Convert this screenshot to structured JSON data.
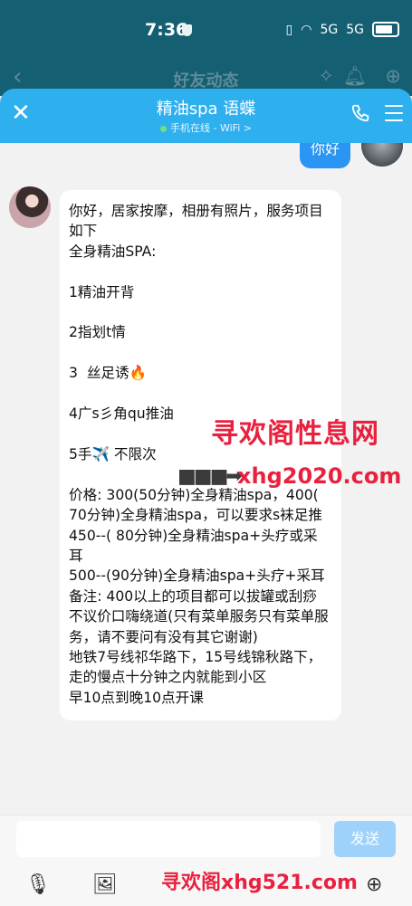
{
  "status": {
    "time": "7:36",
    "signal_5g_1": "5G",
    "signal_5g_2": "5G"
  },
  "background_page": {
    "title": "好友动态"
  },
  "chat": {
    "contact_name": "精油spa 语蝶",
    "online_status": "手机在线 - WiFi >",
    "my_message": "你好",
    "their_message": "你好，居家按摩，相册有照片，服务项目如下\n全身精油SPA:\n\n1精油开背\n\n2指划t情\n\n3  丝足诱🔥\n\n4广s彡角qu推油\n\n5手✈️ 不限次\n\n价格: 300(50分钟)全身精油spa，400( 70分钟)全身精油spa，可以要求s袜足推\n450--( 80分钟)全身精油spa+头疗或采耳\n500--(90分钟)全身精油spa+头疗+采耳\n备注: 400以上的项目都可以拔罐或刮痧不议价口嗨绕道(只有菜单服务只有菜单服务，请不要问有没有其它谢谢)\n地铁7号线祁华路下，15号线锦秋路下，走的慢点十分钟之内就能到小区\n早10点到晚10点开课"
  },
  "watermarks": {
    "top": "寻欢阁性息网",
    "middle": "xhg2020.com",
    "bottom": "寻欢阁xhg521.com"
  },
  "input": {
    "send_label": "发送"
  },
  "icons": {
    "mic": "mic-icon",
    "image": "image-icon",
    "add": "add-icon"
  }
}
